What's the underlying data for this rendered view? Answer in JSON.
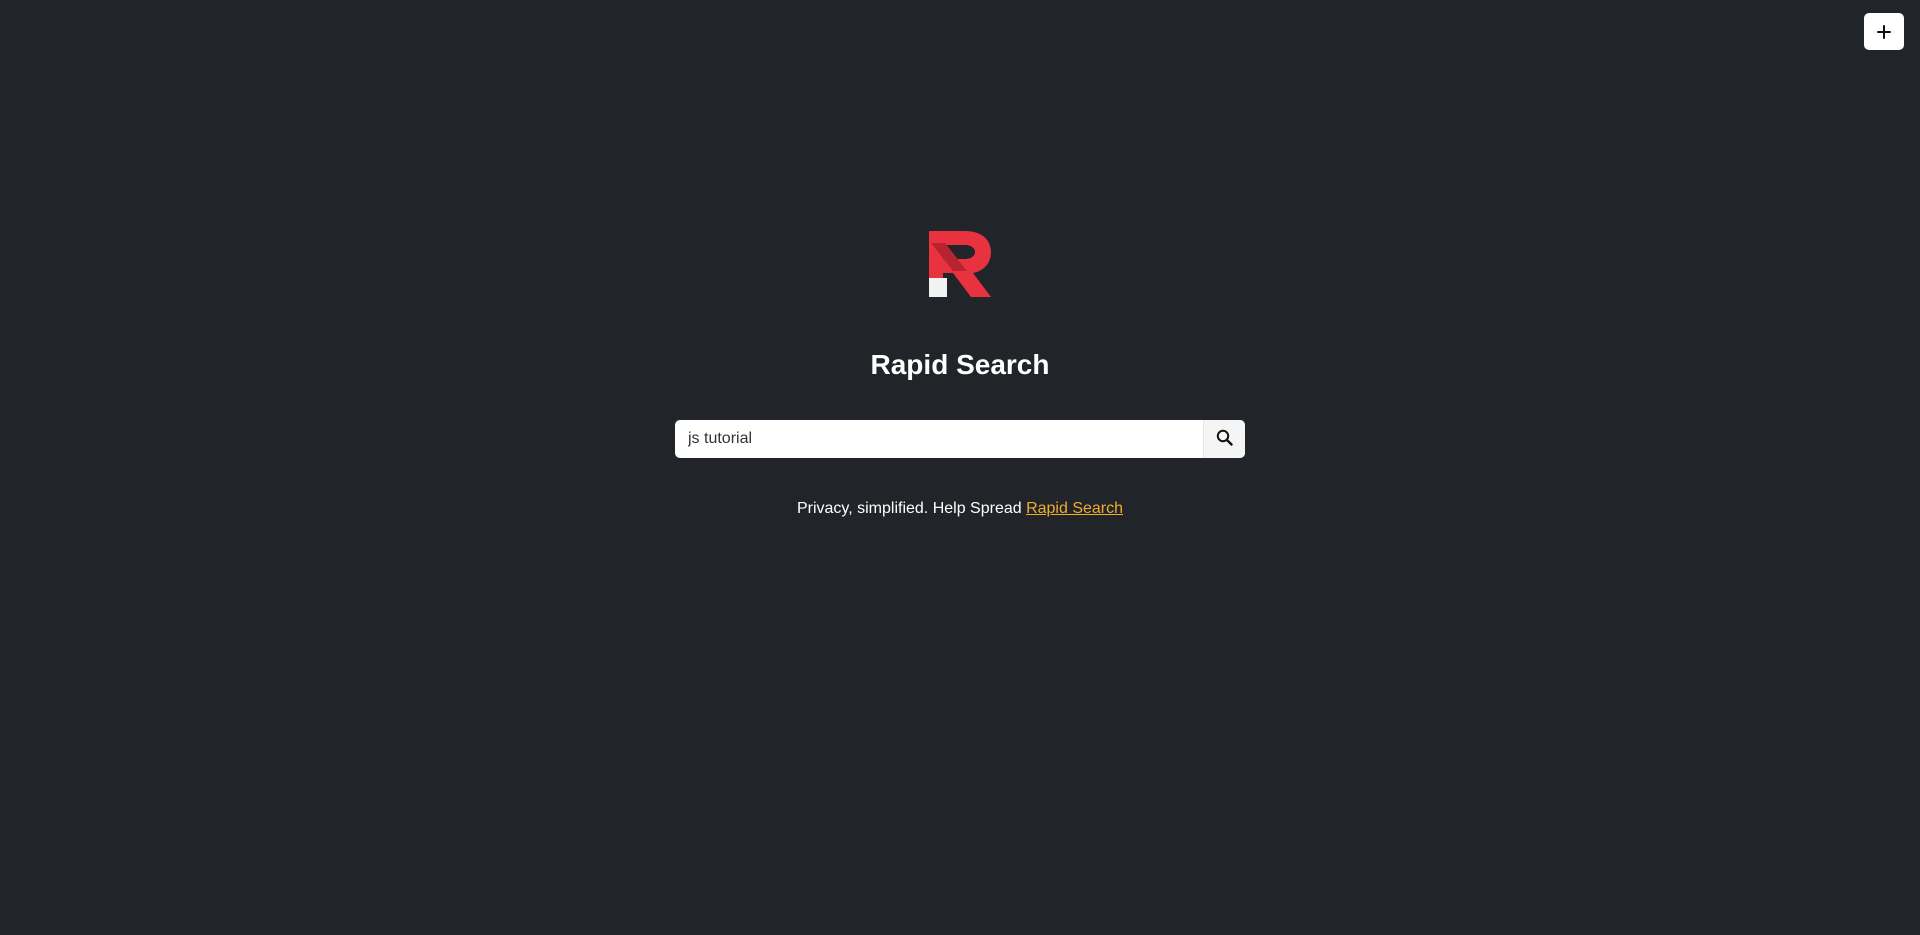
{
  "app": {
    "title": "Rapid Search",
    "logo_icon": "rapid-search-r-logo",
    "accent_color": "#e8323f",
    "link_color": "#f0ad2e",
    "background_color": "#212429"
  },
  "toolbar": {
    "add_icon": "plus-icon"
  },
  "search": {
    "value": "js tutorial",
    "placeholder": "",
    "button_icon": "search-icon"
  },
  "footer": {
    "tagline_text": "Privacy, simplified. Help Spread ",
    "link_text": "Rapid Search"
  }
}
